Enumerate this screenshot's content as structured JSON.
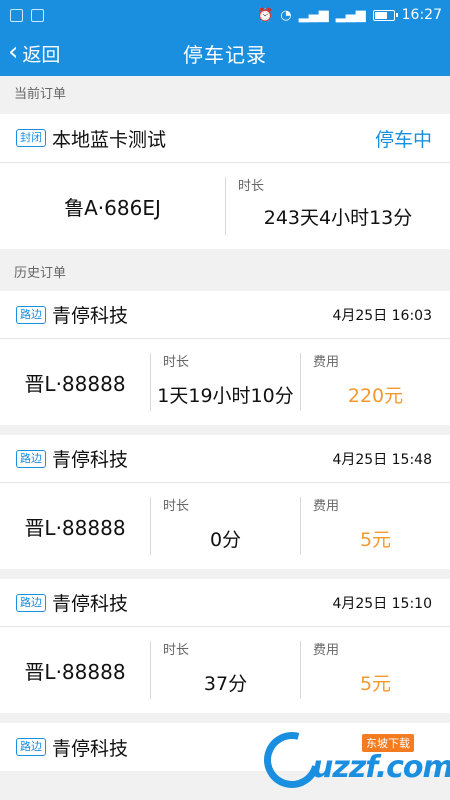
{
  "statusbar": {
    "time": "16:27",
    "network_badges": [
      "4G",
      "2G"
    ]
  },
  "nav": {
    "back_label": "返回",
    "title": "停车记录"
  },
  "current": {
    "section_label": "当前订单",
    "tag": "封闭",
    "name": "本地蓝卡测试",
    "status": "停车中",
    "plate": "鲁A·686EJ",
    "duration_label": "时长",
    "duration": "243天4小时13分"
  },
  "history": {
    "section_label": "历史订单",
    "duration_label": "时长",
    "fee_label": "费用",
    "orders": [
      {
        "tag": "路边",
        "name": "青停科技",
        "time": "4月25日 16:03",
        "plate": "晋L·88888",
        "duration": "1天19小时10分",
        "fee": "220元"
      },
      {
        "tag": "路边",
        "name": "青停科技",
        "time": "4月25日 15:48",
        "plate": "晋L·88888",
        "duration": "0分",
        "fee": "5元"
      },
      {
        "tag": "路边",
        "name": "青停科技",
        "time": "4月25日 15:10",
        "plate": "晋L·88888",
        "duration": "37分",
        "fee": "5元"
      },
      {
        "tag": "路边",
        "name": "青停科技"
      }
    ]
  },
  "watermark": {
    "text": "uzzf.com",
    "badge": "东坡下载"
  },
  "colors": {
    "primary": "#1a8fe0",
    "fee": "#f29a2e"
  }
}
